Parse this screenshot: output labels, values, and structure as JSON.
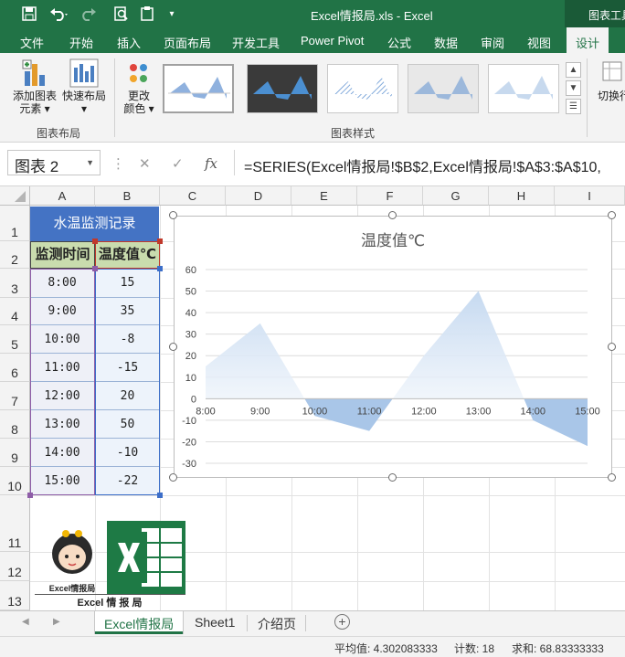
{
  "titlebar": {
    "title": "Excel情报局.xls - Excel",
    "contextual_tab": "图表工具",
    "save_icon": "save-icon",
    "undo_icon": "undo-icon",
    "redo_icon": "redo-icon",
    "preview_icon": "print-preview-icon",
    "customize_icon": "customize-quick-access-icon"
  },
  "tabs": [
    "文件",
    "开始",
    "插入",
    "页面布局",
    "开发工具",
    "Power Pivot",
    "公式",
    "数据",
    "审阅",
    "视图",
    "设计"
  ],
  "active_tab": "设计",
  "ribbon": {
    "add_element_line1": "添加图表",
    "add_element_line2": "元素",
    "quick_layout_line1": "快速布局",
    "group_layout": "图表布局",
    "change_colors_line1": "更改",
    "change_colors_line2": "颜色",
    "group_styles": "图表样式",
    "switch_label": "切换行"
  },
  "formula_bar": {
    "name_box": "图表 2",
    "cancel_icon": "✕",
    "enter_icon": "✓",
    "fx_label": "fx",
    "formula": "=SERIES(Excel情报局!$B$2,Excel情报局!$A$3:$A$10,"
  },
  "columns": [
    "A",
    "B",
    "C",
    "D",
    "E",
    "F",
    "G",
    "H",
    "I"
  ],
  "rows": [
    "1",
    "2",
    "3",
    "4",
    "5",
    "6",
    "7",
    "8",
    "9",
    "10",
    "11",
    "12",
    "13"
  ],
  "table": {
    "title": "水温监测记录",
    "header_time": "监测时间",
    "header_value": "温度值℃",
    "times": [
      "8:00",
      "9:00",
      "10:00",
      "11:00",
      "12:00",
      "13:00",
      "14:00",
      "15:00"
    ],
    "values": [
      "15",
      "35",
      "-8",
      "-15",
      "20",
      "50",
      "-10",
      "-22"
    ]
  },
  "chart_data": {
    "type": "area",
    "title": "温度值℃",
    "categories": [
      "8:00",
      "9:00",
      "10:00",
      "11:00",
      "12:00",
      "13:00",
      "14:00",
      "15:00"
    ],
    "series": [
      {
        "name": "温度值℃",
        "values": [
          15,
          35,
          -8,
          -15,
          20,
          50,
          -10,
          -22
        ]
      }
    ],
    "ylim": [
      -30,
      60
    ],
    "yticks": [
      "60",
      "50",
      "40",
      "30",
      "20",
      "10",
      "0",
      "-10",
      "-20",
      "-30"
    ],
    "grid": true,
    "legend": "none",
    "fill_top_color": "#c5d9f0",
    "fill_bottom_color": "#ffffff",
    "neg_fill_color": "#a9c6e8"
  },
  "logo": {
    "person_caption": "Excel情报局",
    "bottom_caption": "Excel 情 报 局"
  },
  "sheets": [
    "Excel情报局",
    "Sheet1",
    "介绍页"
  ],
  "active_sheet": "Excel情报局",
  "status": {
    "average": "平均值: 4.302083333",
    "count": "计数: 18",
    "sum": "求和: 68.83333333"
  },
  "colors": {
    "excel_green": "#217346",
    "title_blue": "#4473c4",
    "header_green": "#c9dcae"
  }
}
